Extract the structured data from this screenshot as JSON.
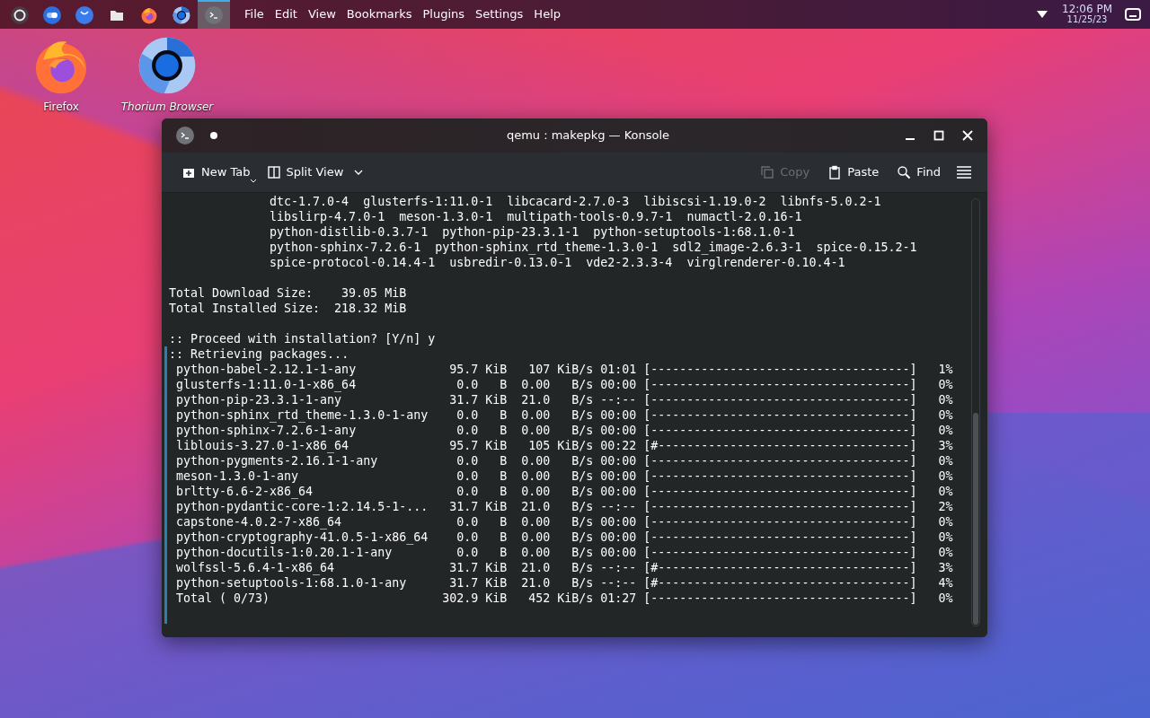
{
  "panel": {
    "tasks": [
      {
        "kind": "launcher",
        "selected": false
      },
      {
        "kind": "toggle",
        "selected": false
      },
      {
        "kind": "store",
        "selected": false
      },
      {
        "kind": "files",
        "selected": false
      },
      {
        "kind": "firefox",
        "selected": false
      },
      {
        "kind": "thorium",
        "selected": false
      },
      {
        "kind": "konsole",
        "selected": true
      }
    ],
    "menu": [
      "File",
      "Edit",
      "View",
      "Bookmarks",
      "Plugins",
      "Settings",
      "Help"
    ],
    "clock": {
      "time": "12:06 PM",
      "date": "11/25/23"
    }
  },
  "desktop_icons": [
    {
      "kind": "firefox",
      "label": "Firefox"
    },
    {
      "kind": "thorium",
      "label": "Thorium Browser"
    }
  ],
  "window": {
    "title": "qemu : makepkg — Konsole"
  },
  "toolbar": {
    "left": [
      {
        "kind": "new-tab",
        "label": "New Tab"
      },
      {
        "kind": "split",
        "label": "Split View"
      }
    ],
    "right": [
      {
        "kind": "copy",
        "label": "Copy",
        "disabled": true
      },
      {
        "kind": "paste",
        "label": "Paste",
        "disabled": false
      },
      {
        "kind": "find",
        "label": "Find",
        "disabled": false
      }
    ]
  },
  "terminal": {
    "package_lines": [
      "dtc-1.7.0-4  glusterfs-1:11.0-1  libcacard-2.7.0-3  libiscsi-1.19.0-2  libnfs-5.0.2-1",
      "libslirp-4.7.0-1  meson-1.3.0-1  multipath-tools-0.9.7-1  numactl-2.0.16-1",
      "python-distlib-0.3.7-1  python-pip-23.3.1-1  python-setuptools-1:68.1.0-1",
      "python-sphinx-7.2.6-1  python-sphinx_rtd_theme-1.3.0-1  sdl2_image-2.6.3-1  spice-0.15.2-1",
      "spice-protocol-0.14.4-1  usbredir-0.13.0-1  vde2-2.3.3-4  virglrenderer-0.10.4-1"
    ],
    "totals": [
      {
        "label": "Total Download Size:",
        "value": "39.05 MiB"
      },
      {
        "label": "Total Installed Size:",
        "value": "218.32 MiB"
      }
    ],
    "prompt": ":: Proceed with installation? [Y/n] y",
    "status": ":: Retrieving packages...",
    "downloads": [
      {
        "name": "python-babel-2.12.1-1-any",
        "size": "95.7",
        "size_unit": "KiB",
        "rate": "107",
        "rate_unit": "KiB/s",
        "eta": "01:01",
        "bar": "[------------------------------------]",
        "percent": "1%"
      },
      {
        "name": "glusterfs-1:11.0-1-x86_64",
        "size": "0.0",
        "size_unit": "B",
        "rate": "0.00",
        "rate_unit": "B/s",
        "eta": "00:00",
        "bar": "[------------------------------------]",
        "percent": "0%"
      },
      {
        "name": "python-pip-23.3.1-1-any",
        "size": "31.7",
        "size_unit": "KiB",
        "rate": "21.0",
        "rate_unit": "B/s",
        "eta": "--:--",
        "bar": "[------------------------------------]",
        "percent": "0%"
      },
      {
        "name": "python-sphinx_rtd_theme-1.3.0-1-any",
        "size": "0.0",
        "size_unit": "B",
        "rate": "0.00",
        "rate_unit": "B/s",
        "eta": "00:00",
        "bar": "[------------------------------------]",
        "percent": "0%"
      },
      {
        "name": "python-sphinx-7.2.6-1-any",
        "size": "0.0",
        "size_unit": "B",
        "rate": "0.00",
        "rate_unit": "B/s",
        "eta": "00:00",
        "bar": "[------------------------------------]",
        "percent": "0%"
      },
      {
        "name": "liblouis-3.27.0-1-x86_64",
        "size": "95.7",
        "size_unit": "KiB",
        "rate": "105",
        "rate_unit": "KiB/s",
        "eta": "00:22",
        "bar": "[#-----------------------------------]",
        "percent": "3%"
      },
      {
        "name": "python-pygments-2.16.1-1-any",
        "size": "0.0",
        "size_unit": "B",
        "rate": "0.00",
        "rate_unit": "B/s",
        "eta": "00:00",
        "bar": "[------------------------------------]",
        "percent": "0%"
      },
      {
        "name": "meson-1.3.0-1-any",
        "size": "0.0",
        "size_unit": "B",
        "rate": "0.00",
        "rate_unit": "B/s",
        "eta": "00:00",
        "bar": "[------------------------------------]",
        "percent": "0%"
      },
      {
        "name": "brltty-6.6-2-x86_64",
        "size": "0.0",
        "size_unit": "B",
        "rate": "0.00",
        "rate_unit": "B/s",
        "eta": "00:00",
        "bar": "[------------------------------------]",
        "percent": "0%"
      },
      {
        "name": "python-pydantic-core-1:2.14.5-1-...",
        "size": "31.7",
        "size_unit": "KiB",
        "rate": "21.0",
        "rate_unit": "B/s",
        "eta": "--:--",
        "bar": "[------------------------------------]",
        "percent": "2%"
      },
      {
        "name": "capstone-4.0.2-7-x86_64",
        "size": "0.0",
        "size_unit": "B",
        "rate": "0.00",
        "rate_unit": "B/s",
        "eta": "00:00",
        "bar": "[------------------------------------]",
        "percent": "0%"
      },
      {
        "name": "python-cryptography-41.0.5-1-x86_64",
        "size": "0.0",
        "size_unit": "B",
        "rate": "0.00",
        "rate_unit": "B/s",
        "eta": "00:00",
        "bar": "[------------------------------------]",
        "percent": "0%"
      },
      {
        "name": "python-docutils-1:0.20.1-1-any",
        "size": "0.0",
        "size_unit": "B",
        "rate": "0.00",
        "rate_unit": "B/s",
        "eta": "00:00",
        "bar": "[------------------------------------]",
        "percent": "0%"
      },
      {
        "name": "wolfssl-5.6.4-1-x86_64",
        "size": "31.7",
        "size_unit": "KiB",
        "rate": "21.0",
        "rate_unit": "B/s",
        "eta": "--:--",
        "bar": "[#-----------------------------------]",
        "percent": "3%"
      },
      {
        "name": "python-setuptools-1:68.1.0-1-any",
        "size": "31.7",
        "size_unit": "KiB",
        "rate": "21.0",
        "rate_unit": "B/s",
        "eta": "--:--",
        "bar": "[#-----------------------------------]",
        "percent": "4%"
      },
      {
        "name": "Total ( 0/73)",
        "size": "302.9",
        "size_unit": "KiB",
        "rate": "452",
        "rate_unit": "KiB/s",
        "eta": "01:27",
        "bar": "[------------------------------------]",
        "percent": "0%"
      }
    ]
  }
}
